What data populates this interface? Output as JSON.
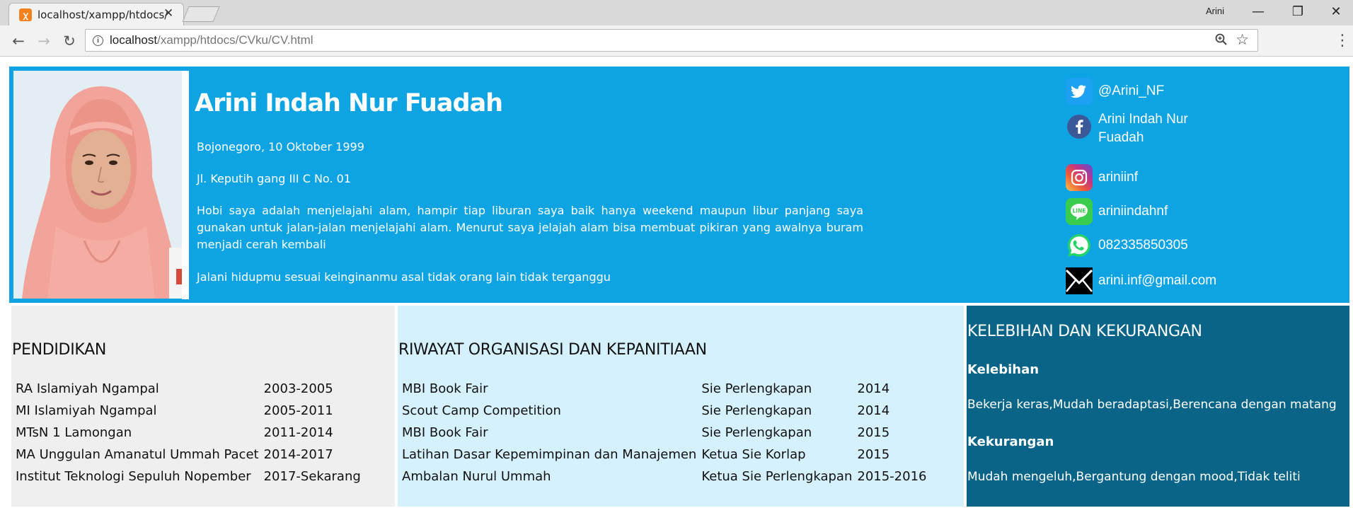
{
  "browser": {
    "tab_title": "localhost/xampp/htdocs/",
    "tab_close": "✕",
    "user_label": "Arini",
    "url_host": "localhost",
    "url_path": "/xampp/htdocs/CVku/CV.html"
  },
  "profile": {
    "name": "Arini Indah Nur Fuadah",
    "birth": "Bojonegoro, 10 Oktober 1999",
    "address": "Jl. Keputih gang III C No. 01",
    "hobby": "Hobi saya adalah menjelajahi alam, hampir tiap liburan saya baik hanya weekend maupun libur panjang saya gunakan untuk jalan-jalan menjelajahi alam. Menurut saya jelajah alam bisa membuat pikiran yang awalnya buram menjadi cerah kembali",
    "motto": "Jalani hidupmu sesuai keinginanmu asal tidak orang lain tidak terganggu"
  },
  "contacts": [
    {
      "icon": "twitter-icon",
      "text": "@Arini_NF",
      "color": "#1da1f2"
    },
    {
      "icon": "facebook-icon",
      "text": "Arini Indah Nur Fuadah",
      "color": "#3b5998"
    },
    {
      "icon": "instagram-icon",
      "text": "ariniinf",
      "color": "#c13584"
    },
    {
      "icon": "line-icon",
      "text": "ariniindahnf",
      "color": "#3acc4c"
    },
    {
      "icon": "whatsapp-icon",
      "text": "082335850305",
      "color": "#25d366"
    },
    {
      "icon": "email-icon",
      "text": "arini.inf@gmail.com",
      "color": "#000000"
    }
  ],
  "education": {
    "title": "PENDIDIKAN",
    "rows": [
      [
        "RA Islamiyah Ngampal",
        "2003-2005"
      ],
      [
        "MI Islamiyah Ngampal",
        "2005-2011"
      ],
      [
        "MTsN 1 Lamongan",
        "2011-2014"
      ],
      [
        "MA Unggulan Amanatul Ummah Pacet",
        "2014-2017"
      ],
      [
        "Institut Teknologi Sepuluh Nopember",
        "2017-Sekarang"
      ]
    ]
  },
  "organization": {
    "title": "RIWAYAT ORGANISASI DAN KEPANITIAAN",
    "rows": [
      [
        "MBI Book Fair",
        "Sie Perlengkapan",
        "2014"
      ],
      [
        "Scout Camp Competition",
        "Sie Perlengkapan",
        "2014"
      ],
      [
        "MBI Book Fair",
        "Sie Perlengkapan",
        "2015"
      ],
      [
        "Latihan Dasar Kepemimpinan dan Manajemen",
        "Ketua Sie Korlap",
        "2015"
      ],
      [
        "Ambalan Nurul Ummah",
        "Ketua Sie Perlengkapan",
        "2015-2016"
      ]
    ]
  },
  "skills": {
    "title": "KELEBIHAN DAN KEKURANGAN",
    "strength_label": "Kelebihan",
    "strength_text": "Bekerja keras,Mudah beradaptasi,Berencana dengan matang",
    "weakness_label": "Kekurangan",
    "weakness_text": "Mudah mengeluh,Bergantung dengan mood,Tidak teliti"
  },
  "colors": {
    "header_bg": "#0ea4e3",
    "education_bg": "#efefef",
    "organization_bg": "#d5f1fd",
    "skills_bg": "#0a6487"
  }
}
